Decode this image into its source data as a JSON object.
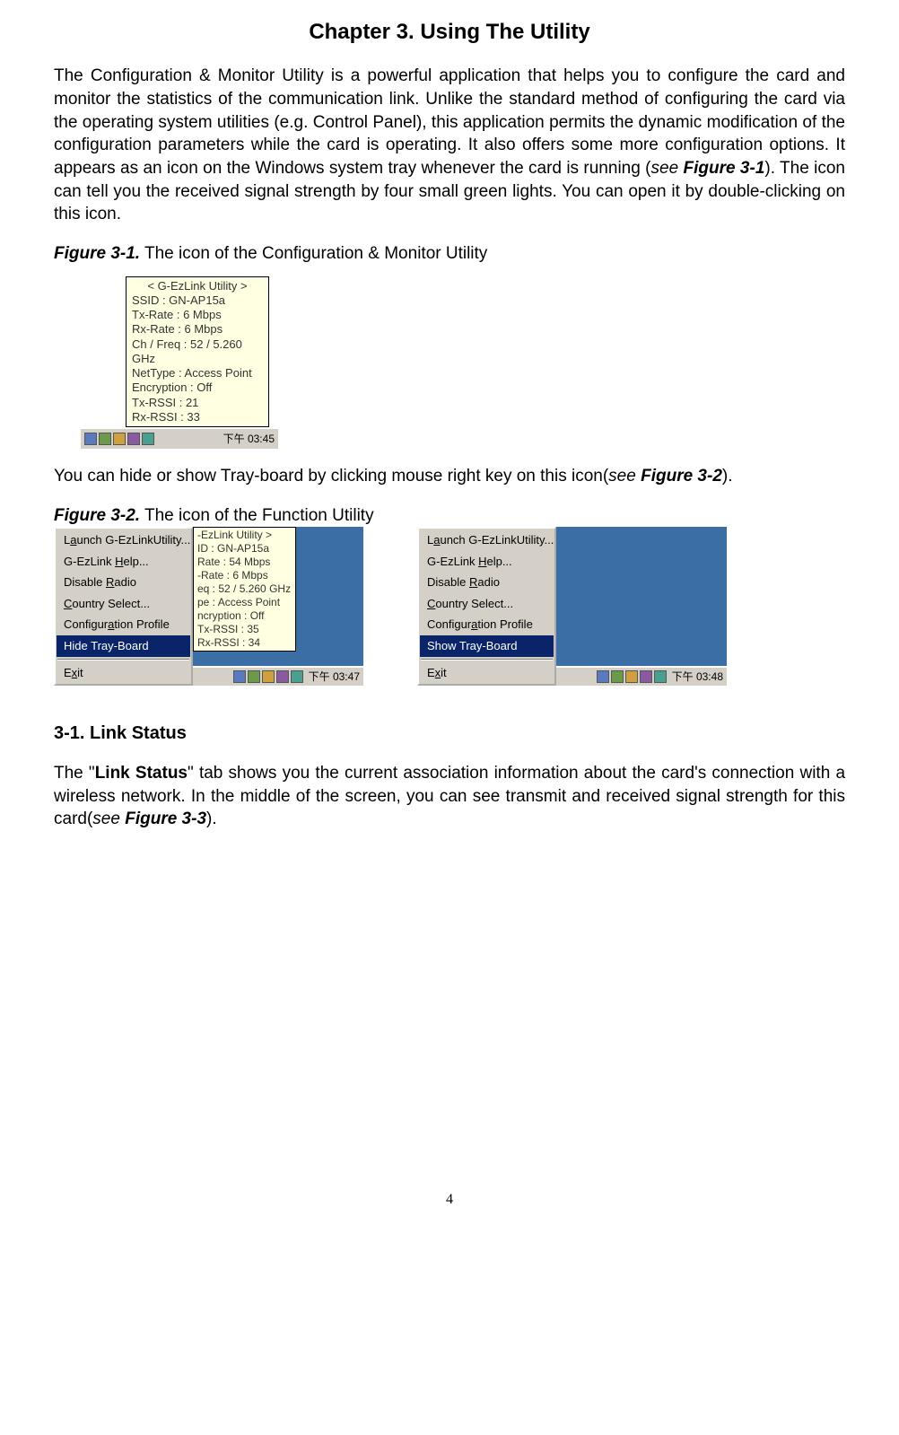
{
  "chapter": {
    "title": "Chapter 3. Using The Utility"
  },
  "intro": {
    "part1": "The Configuration & Monitor Utility is a powerful application that helps you to configure the card and monitor the statistics of the communication link. Unlike the standard method of configuring the card via the operating system utilities (e.g. Control Panel), this application permits the dynamic modification of the configuration parameters while the card is operating. It also offers some more configuration options. It appears as an icon on the Windows system tray whenever the card is running (",
    "see": "see ",
    "figref1": "Figure 3-1",
    "part2": "). The icon can tell you the received signal strength by four small green lights. You can open it by double-clicking on this icon."
  },
  "fig31": {
    "label": "Figure 3-1.",
    "caption": "   The icon of the Configuration & Monitor Utility",
    "tooltip": {
      "title": "< G-EzLink Utility >",
      "ssid": "SSID :  GN-AP15a",
      "txrate": "Tx-Rate :  6 Mbps",
      "rxrate": "Rx-Rate :  6 Mbps",
      "chfreq": "Ch / Freq :  52 / 5.260 GHz",
      "nettype": "NetType :  Access Point",
      "encryption": "Encryption :  Off",
      "txrssi": "Tx-RSSI :  21",
      "rxrssi": "Rx-RSSI :  33"
    },
    "tray_time": "下午 03:45"
  },
  "mid_para": {
    "part1": "You can hide or show Tray-board by clicking mouse right key on this icon(",
    "see": "see ",
    "figref": "Figure 3-2",
    "part2": ")."
  },
  "fig32": {
    "label": "Figure 3-2.",
    "caption": "   The icon of the Function Utility",
    "menu_left": {
      "launch_pre": "L",
      "launch_u": "a",
      "launch_post": "unch G-EzLinkUtility...",
      "help_pre": "G-EzLink ",
      "help_u": "H",
      "help_post": "elp...",
      "radio_pre": "Disable ",
      "radio_u": "R",
      "radio_post": "adio",
      "country_u": "C",
      "country_post": "ountry Select...",
      "profile_pre": "Configur",
      "profile_u": "a",
      "profile_post": "tion Profile",
      "hide": "Hide Tray-Board",
      "exit_pre": "E",
      "exit_u": "x",
      "exit_post": "it"
    },
    "menu_right": {
      "show": "Show Tray-Board"
    },
    "tooltip_left": {
      "l1": "-EzLink Utility >",
      "l2": "ID :  GN-AP15a",
      "l3": "Rate :  54 Mbps",
      "l4": "-Rate :  6 Mbps",
      "l5": "eq :  52 / 5.260 GHz",
      "l6": "pe :  Access Point",
      "l7": "ncryption :  Off",
      "l8": "Tx-RSSI :  35",
      "l9": "Rx-RSSI :  34"
    },
    "time_left": "下午 03:47",
    "time_right": "下午 03:48"
  },
  "section": {
    "heading": "3-1.   Link Status",
    "para_pre": "The \"",
    "link_status": "Link Status",
    "para_mid": "\" tab shows you the current association information about the card's connection with a wireless network. In the middle of the screen, you can see transmit and received signal strength for this card(",
    "see": "see ",
    "figref": "Figure 3-3",
    "para_post": ")."
  },
  "page_number": "4"
}
